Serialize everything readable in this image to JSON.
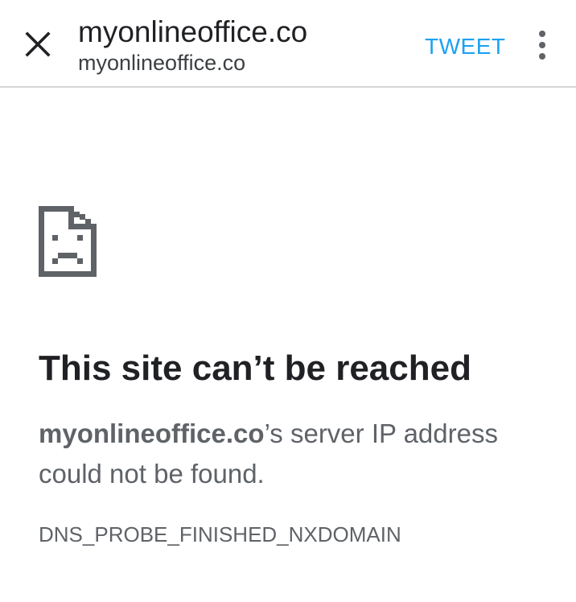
{
  "toolbar": {
    "title": "myonlineoffice.co",
    "url": "myonlineoffice.co",
    "tweet_label": "TWEET",
    "close_icon": "close-icon",
    "menu_icon": "more-vert-icon",
    "accent_color": "#1da1f2"
  },
  "error": {
    "icon": "sad-page-icon",
    "heading": "This site can’t be reached",
    "host": "myonlineoffice.co",
    "message_rest": "’s server IP address could not be found.",
    "code": "DNS_PROBE_FINISHED_NXDOMAIN"
  }
}
